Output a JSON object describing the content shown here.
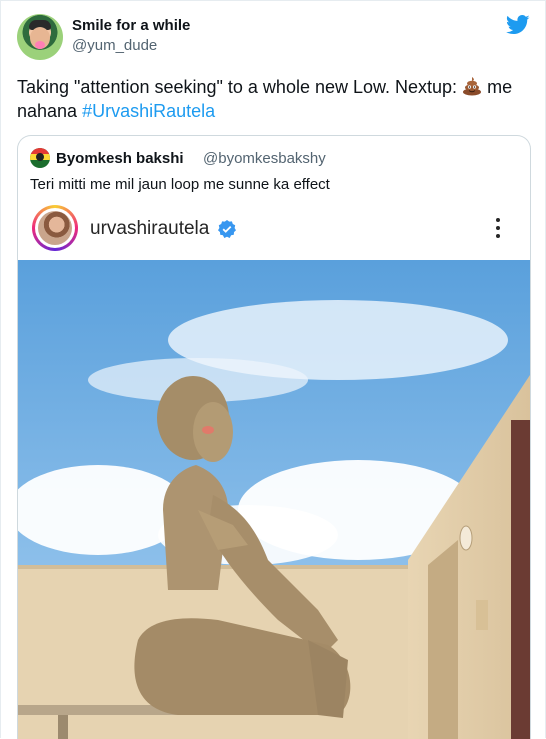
{
  "author": {
    "name": "Smile for a while",
    "handle": "@yum_dude"
  },
  "tweet": {
    "text_before": "Taking \"attention seeking\" to a whole new Low. Nextup: ",
    "text_after": " me nahana ",
    "hashtag": "#UrvashiRautela"
  },
  "quoted": {
    "name": "Byomkesh bakshi",
    "handle": "@byomkesbakshy",
    "text": "Teri mitti me mil jaun loop me sunne ka effect"
  },
  "instagram": {
    "username": "urvashirautela"
  },
  "colors": {
    "link": "#1d9bf0",
    "twitter_blue": "#1d9bf0",
    "verified": "#3897f0"
  },
  "icons": [
    "twitter-bird-icon",
    "poop-emoji-icon",
    "verified-badge-icon",
    "more-options-icon"
  ]
}
